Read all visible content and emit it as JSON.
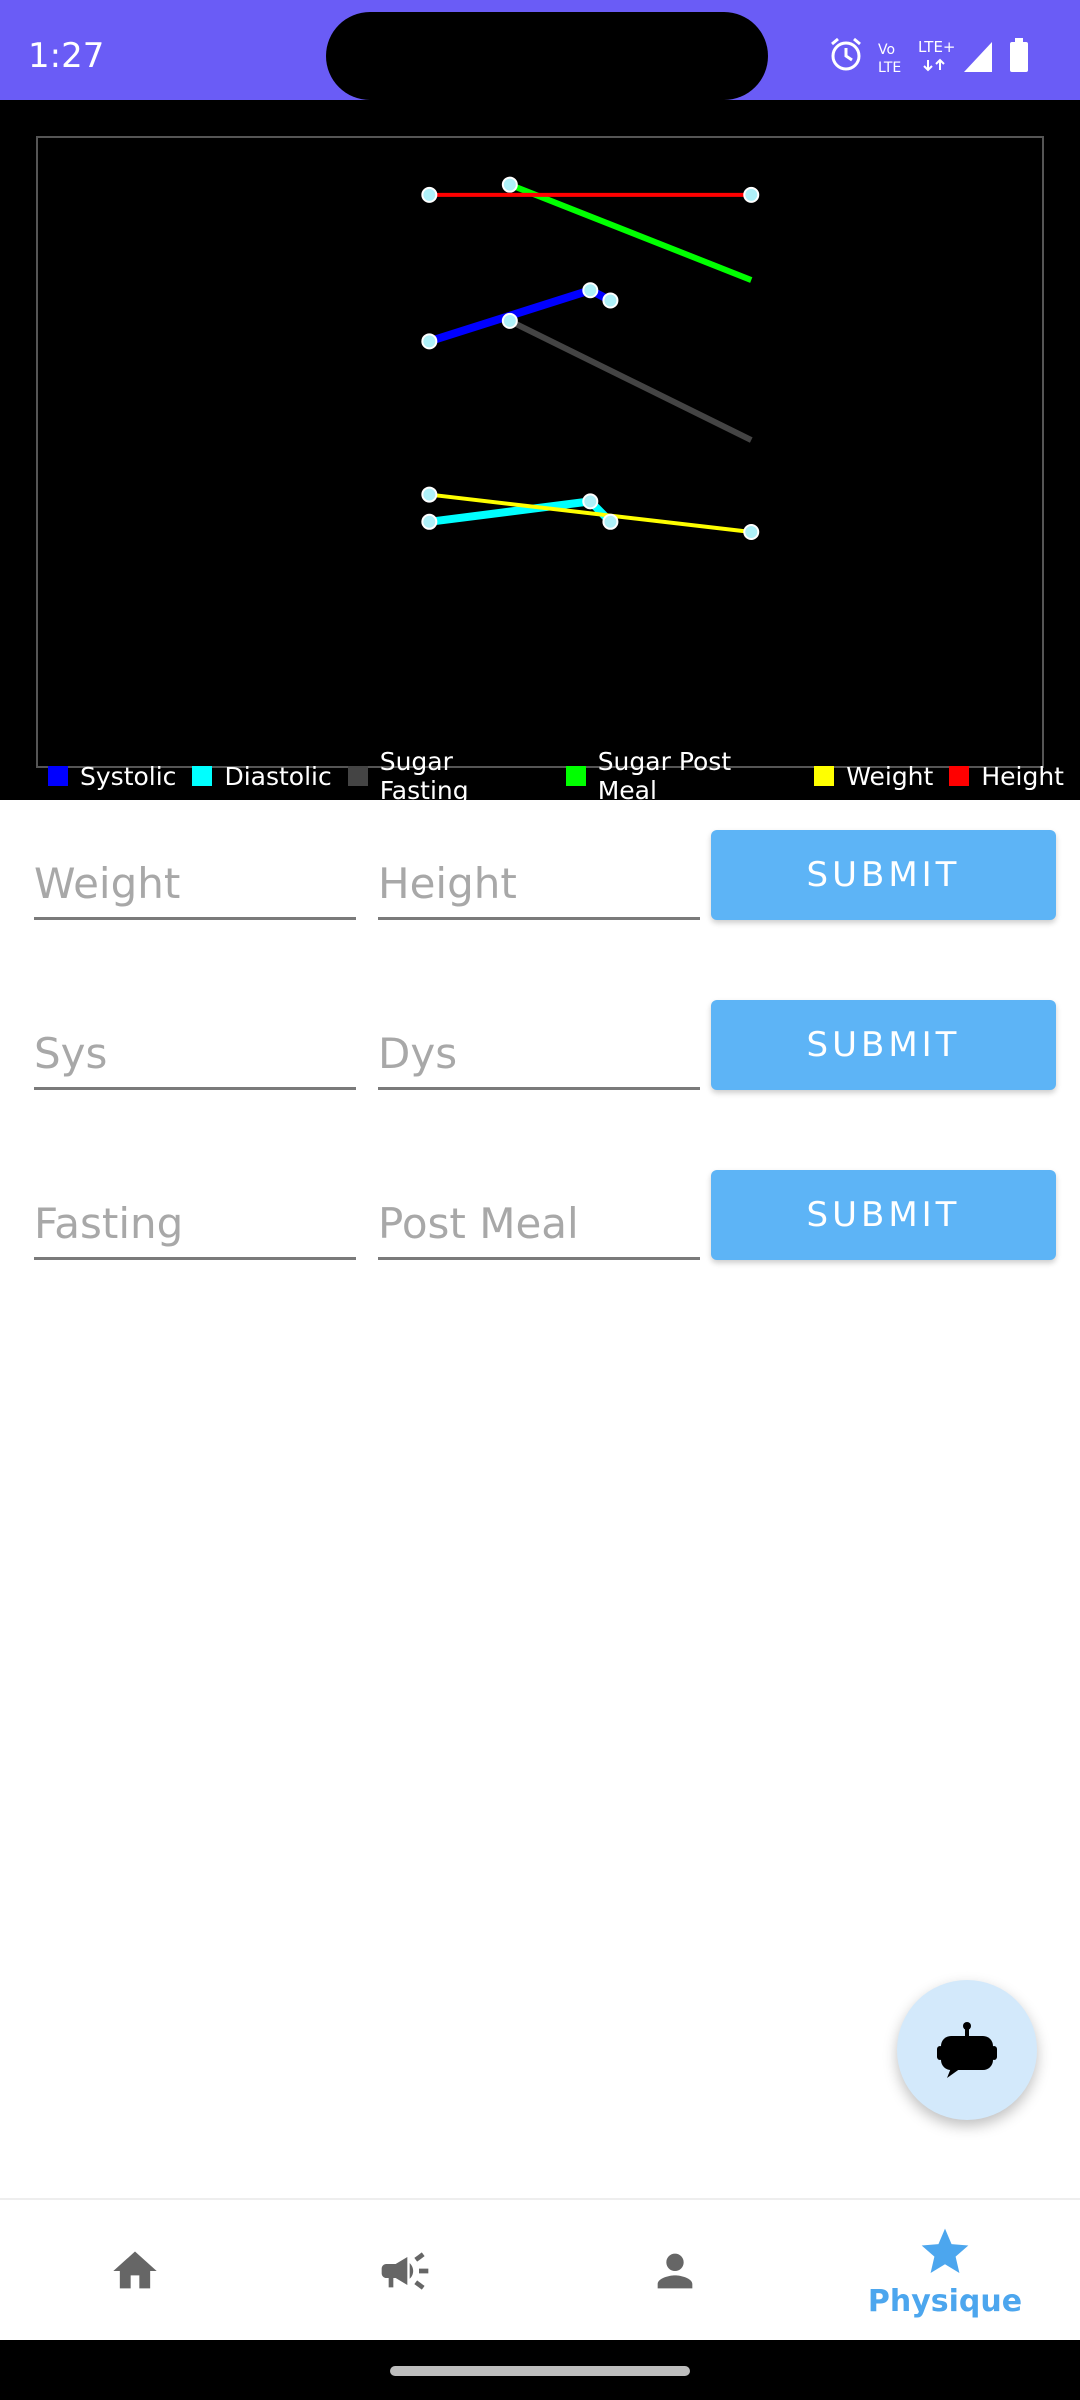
{
  "status_bar": {
    "time": "1:27",
    "icons": [
      "alarm-icon",
      "volte-icon",
      "lte-plus-icon",
      "signal-icon",
      "battery-icon"
    ],
    "volte_text_top": "Vo",
    "volte_text_bottom": "LTE",
    "lte_text": "LTE+",
    "color": "#6a5cf6"
  },
  "chart_data": {
    "type": "line",
    "title": "",
    "xlabel": "",
    "ylabel": "",
    "grid": false,
    "legend_position": "bottom",
    "series": [
      {
        "name": "Systolic",
        "color": "#0000ff",
        "points": [
          [
            0.39,
            125
          ],
          [
            0.55,
            140
          ],
          [
            0.57,
            137
          ]
        ]
      },
      {
        "name": "Diastolic",
        "color": "#00ffff",
        "points": [
          [
            0.39,
            72
          ],
          [
            0.55,
            78
          ],
          [
            0.57,
            72
          ]
        ]
      },
      {
        "name": "Sugar Fasting",
        "color": "#444444",
        "points": [
          [
            0.47,
            131
          ],
          [
            0.71,
            96
          ]
        ]
      },
      {
        "name": "Sugar Post Meal",
        "color": "#00ff00",
        "points": [
          [
            0.47,
            171
          ],
          [
            0.71,
            143
          ]
        ]
      },
      {
        "name": "Weight",
        "color": "#ffff00",
        "points": [
          [
            0.39,
            80
          ],
          [
            0.71,
            69
          ]
        ]
      },
      {
        "name": "Height",
        "color": "#ff0000",
        "points": [
          [
            0.39,
            168
          ],
          [
            0.71,
            168
          ]
        ]
      }
    ],
    "markers": [
      [
        0.39,
        168
      ],
      [
        0.47,
        171
      ],
      [
        0.71,
        168
      ],
      [
        0.55,
        140
      ],
      [
        0.57,
        137
      ],
      [
        0.39,
        125
      ],
      [
        0.47,
        131
      ],
      [
        0.39,
        80
      ],
      [
        0.39,
        72
      ],
      [
        0.55,
        78
      ],
      [
        0.57,
        72
      ],
      [
        0.71,
        69
      ]
    ],
    "marker_color": "#aef0f8",
    "xlim": [
      0,
      1
    ],
    "ylim": [
      0,
      185
    ]
  },
  "forms": [
    {
      "left_placeholder": "Weight",
      "right_placeholder": "Height",
      "button": "SUBMIT"
    },
    {
      "left_placeholder": "Sys",
      "right_placeholder": "Dys",
      "button": "SUBMIT"
    },
    {
      "left_placeholder": "Fasting",
      "right_placeholder": "Post Meal",
      "button": "SUBMIT"
    }
  ],
  "fab": {
    "icon": "chatbot-icon"
  },
  "bottom_nav": {
    "items": [
      {
        "icon": "home-icon",
        "label": ""
      },
      {
        "icon": "megaphone-icon",
        "label": ""
      },
      {
        "icon": "person-icon",
        "label": ""
      },
      {
        "icon": "star-icon",
        "label": "Physique",
        "active": true
      }
    ],
    "active_color": "#4ca6ee",
    "inactive_color": "#666666"
  }
}
